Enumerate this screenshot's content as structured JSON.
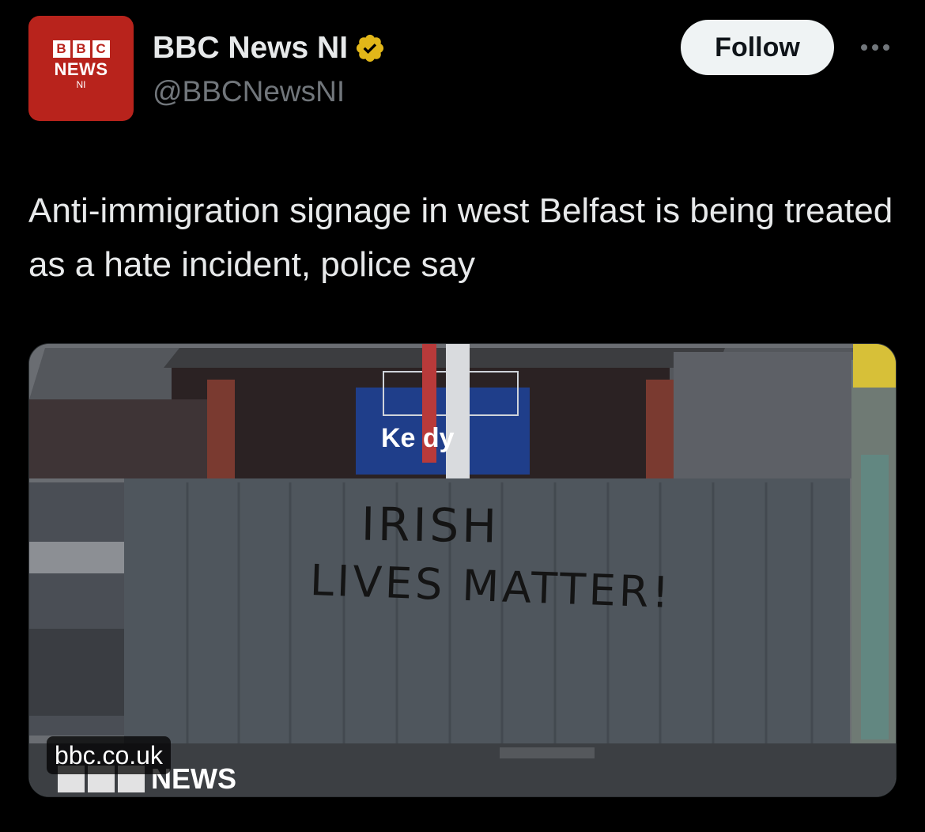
{
  "account": {
    "display_name": "BBC News NI",
    "handle": "@BBCNewsNI",
    "avatar": {
      "blocks": [
        "B",
        "B",
        "C"
      ],
      "news": "NEWS",
      "region": "NI",
      "color": "#b8231c"
    },
    "verified": true,
    "verified_badge_color": "#e2b719"
  },
  "actions": {
    "follow_label": "Follow",
    "more_icon": "more-horizontal-icon"
  },
  "tweet": {
    "text": "Anti-immigration signage in west Belfast is being treated as a hate incident, police say"
  },
  "media": {
    "graffiti_line_1": "IRISH",
    "graffiti_line_2": "LIVES MATTER!",
    "shop_sign": "Ke    dy",
    "watermark": "NEWS",
    "source_label": "bbc.co.uk"
  }
}
